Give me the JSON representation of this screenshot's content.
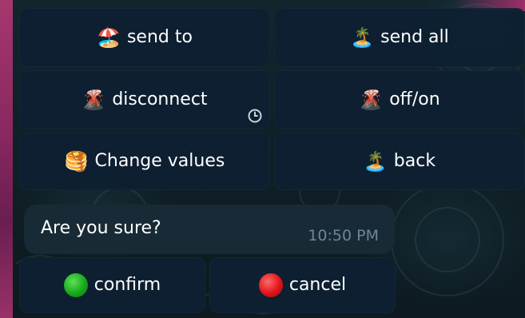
{
  "keyboard": {
    "rows": [
      [
        {
          "emoji": "🏖️",
          "label": "send to"
        },
        {
          "emoji": "🏝️",
          "label": "send all"
        }
      ],
      [
        {
          "emoji": "🌋",
          "label": "disconnect"
        },
        {
          "emoji": "🌋",
          "label": "off/on"
        }
      ],
      [
        {
          "emoji": "🥞",
          "label": "Change values"
        },
        {
          "emoji": "🏝️",
          "label": "back"
        }
      ]
    ]
  },
  "message": {
    "text": "Are you sure?",
    "time": "10:50 PM"
  },
  "inline_buttons": [
    {
      "icon": "green-circle-icon",
      "label": "confirm"
    },
    {
      "icon": "red-circle-icon",
      "label": "cancel"
    }
  ],
  "colors": {
    "button_bg": "#0d2032",
    "message_bg": "#182a35",
    "time_text": "#6f8694",
    "accent_edge": "#c03a7a"
  }
}
